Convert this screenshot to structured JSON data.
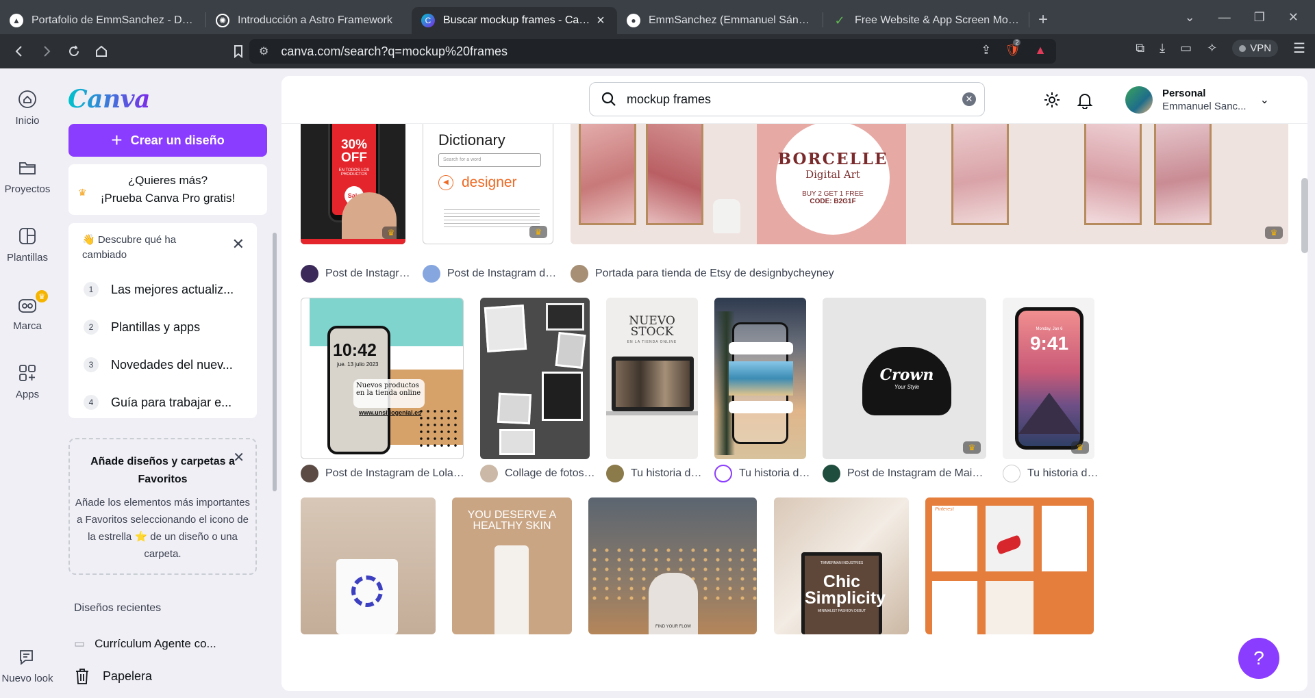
{
  "browser": {
    "tabs": [
      {
        "title": "Portafolio de EmmSanchez - Desarr",
        "icon": "brave-app-icon",
        "color": "#ffffff"
      },
      {
        "title": "Introducción a Astro Framework",
        "icon": "chatgpt-icon",
        "color": "#ffffff"
      },
      {
        "title": "Buscar mockup frames - Canva",
        "icon": "canva-icon",
        "color": "#00c4cc",
        "active": true
      },
      {
        "title": "EmmSanchez (Emmanuel Sánchez)",
        "icon": "github-icon",
        "color": "#ffffff"
      },
      {
        "title": "Free Website & App Screen Mockup",
        "icon": "mockup-site-icon",
        "color": "#5fb850"
      }
    ],
    "new_tab": "+",
    "url": "canva.com/search?q=mockup%20frames",
    "vpn_label": "VPN",
    "shield_count": "2"
  },
  "rail": {
    "items": [
      {
        "label": "Inicio",
        "icon": "home-icon"
      },
      {
        "label": "Proyectos",
        "icon": "folder-icon"
      },
      {
        "label": "Plantillas",
        "icon": "templates-icon"
      },
      {
        "label": "Marca",
        "icon": "brand-icon"
      },
      {
        "label": "Apps",
        "icon": "apps-icon"
      }
    ],
    "new_look": "Nuevo look"
  },
  "panel": {
    "logo": "Canva",
    "create_label": "Crear un diseño",
    "promo_line1": "¿Quieres más?",
    "promo_line2": "¡Prueba Canva Pro gratis!",
    "whats_new_title": "👋 Descubre qué ha cambiado",
    "whats_new_items": [
      {
        "num": "1",
        "label": "Las mejores actualiz..."
      },
      {
        "num": "2",
        "label": "Plantillas y apps"
      },
      {
        "num": "3",
        "label": "Novedades del nuev..."
      },
      {
        "num": "4",
        "label": "Guía para trabajar e..."
      }
    ],
    "favs_title": "Añade diseños y carpetas a Favoritos",
    "favs_body": "Añade los elementos más importantes a Favoritos seleccionando el icono de la estrella ⭐ de un diseño o una carpeta.",
    "recent_title": "Diseños recientes",
    "recent_item": "Currículum Agente co...",
    "trash_label": "Papelera"
  },
  "topbar": {
    "search_value": "mockup frames",
    "account_name": "Personal",
    "account_sub": "Emmanuel Sanc..."
  },
  "results": {
    "row1": [
      {
        "caption": "Post de Instagram ...",
        "text_big": "30% OFF",
        "text_small": "EN TODOS LOS PRODUCTOS",
        "sale": "Sale"
      },
      {
        "caption": "Post de Instagram de Juli...",
        "heading": "Dictionary",
        "search_ph": "Search for a word",
        "word": "designer"
      },
      {
        "caption": "Portada para tienda de Etsy de designbycheyney",
        "brand": "BORCELLE",
        "sub": "Digital Art",
        "promo": "BUY 2 GET 1 FREE",
        "code": "CODE: B2G1F"
      }
    ],
    "row2": [
      {
        "caption": "Post de Instagram de Lola Digital",
        "time": "10:42",
        "date": "jue. 13 julio 2023",
        "text": "Nuevos productos en la tienda online",
        "site": "www.unsitiogenial.es"
      },
      {
        "caption": "Collage de fotos de ..."
      },
      {
        "caption": "Tu historia de ...",
        "title": "NUEVO STOCK",
        "sub": "EN LA TIENDA ONLINE"
      },
      {
        "caption": "Tu historia de S..."
      },
      {
        "caption": "Post de Instagram de Maisyah",
        "cap_text": "Crown",
        "cap_sub": "Your Style"
      },
      {
        "caption": "Tu historia de D...",
        "day": "Monday, Jan 6",
        "time": "9:41"
      }
    ],
    "row3": [
      {
        "caption": ""
      },
      {
        "caption": "",
        "headline": "YOU DESERVE A HEALTHY SKIN"
      },
      {
        "caption": "",
        "text": "FIND YOUR FLOW"
      },
      {
        "caption": "",
        "small": "TIMMERMAN INDUSTRIES",
        "headline": "Chic Simplicity",
        "sub": "MINIMALIST FASHION DEBUT"
      },
      {
        "caption": "",
        "label": "Pinterest"
      }
    ]
  },
  "help_label": "?"
}
